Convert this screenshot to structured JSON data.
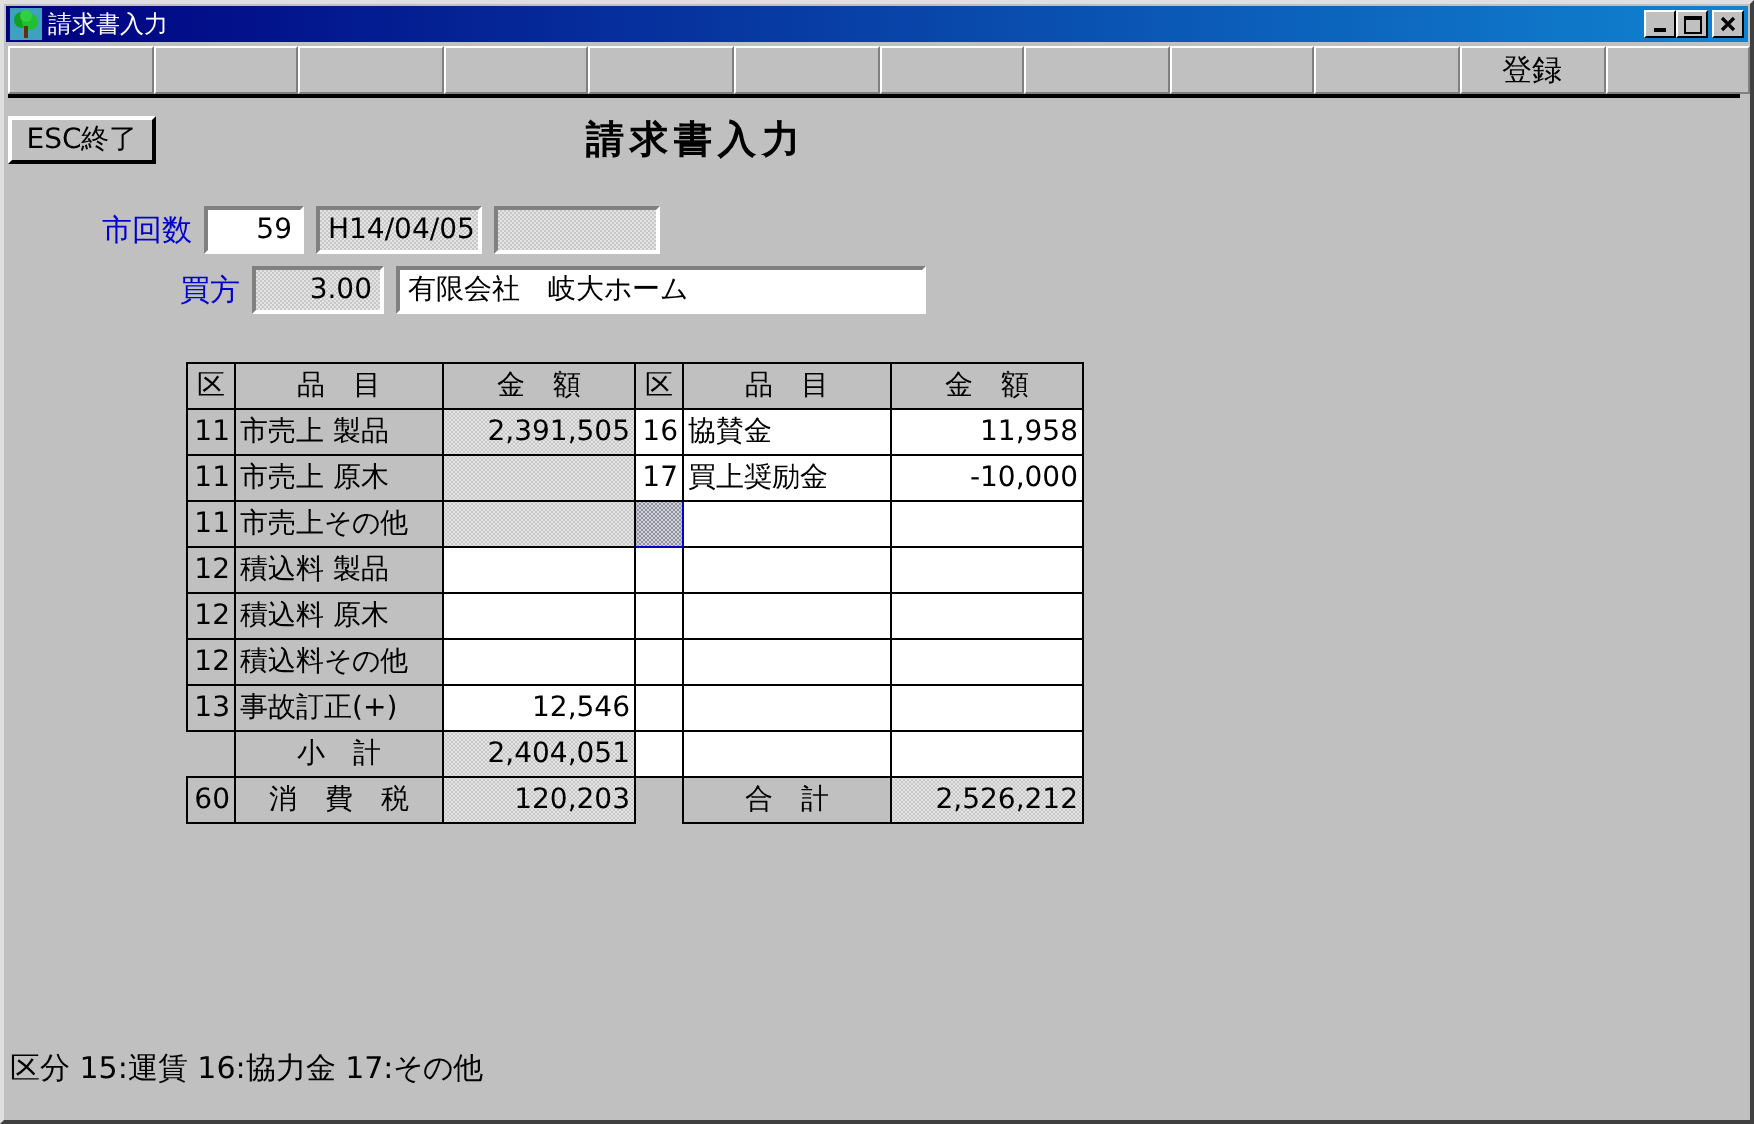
{
  "window": {
    "title": "請求書入力"
  },
  "toolbar": [
    {
      "kind": "blank"
    },
    {
      "kind": "blank"
    },
    {
      "kind": "blank"
    },
    {
      "kind": "blank"
    },
    {
      "kind": "blank"
    },
    {
      "kind": "blank"
    },
    {
      "kind": "blank"
    },
    {
      "kind": "blank"
    },
    {
      "kind": "blank"
    },
    {
      "kind": "blank"
    },
    {
      "kind": "labeled",
      "label": "登録"
    },
    {
      "kind": "blank"
    }
  ],
  "esc_button": "ESC終了",
  "heading": "請求書入力",
  "form_rows": [
    {
      "label": "市回数",
      "fields": [
        {
          "value": "59",
          "readonly": false
        },
        {
          "value": "H14/04/05",
          "readonly": true
        },
        {
          "readonly": true
        }
      ]
    },
    {
      "label": "買方",
      "fields": [
        {
          "value": "3.00",
          "readonly": true
        },
        {
          "value": "有限会社　岐大ホーム",
          "readonly": false
        }
      ]
    }
  ],
  "left_table": {
    "columns": [
      "区",
      "品　目",
      "金　額"
    ],
    "rows": [
      {
        "kind": "item",
        "code": "11",
        "item": "市売上 製品",
        "amount": "2,391,505",
        "readonly": true
      },
      {
        "kind": "item",
        "code": "11",
        "item": "市売上 原木",
        "readonly": true
      },
      {
        "kind": "item",
        "code": "11",
        "item": "市売上その他",
        "readonly": true
      },
      {
        "kind": "item",
        "code": "12",
        "item": "積込料 製品",
        "readonly": false
      },
      {
        "kind": "item",
        "code": "12",
        "item": "積込料 原木",
        "readonly": false
      },
      {
        "kind": "item",
        "code": "12",
        "item": "積込料その他",
        "readonly": false
      },
      {
        "kind": "item",
        "code": "13",
        "item": "事故訂正(+)",
        "amount": "12,546",
        "readonly": false
      },
      {
        "kind": "summary",
        "item": "小　計",
        "amount": "2,404,051",
        "readonly": true
      },
      {
        "kind": "summary_coded",
        "code": "60",
        "item": "消　費　税",
        "amount": "120,203",
        "readonly": true
      }
    ]
  },
  "right_table": {
    "columns": [
      "区",
      "品　目",
      "金　額"
    ],
    "rows": [
      {
        "kind": "item",
        "code": "16",
        "item": "協賛金",
        "amount": "11,958",
        "readonly": false,
        "focused": false
      },
      {
        "kind": "item",
        "code": "17",
        "item": "買上奨励金",
        "amount": "-10,000",
        "readonly": false,
        "focused": false
      },
      {
        "kind": "item",
        "readonly": false,
        "focused": true
      },
      {
        "kind": "item",
        "readonly": false,
        "focused": false
      },
      {
        "kind": "item",
        "readonly": false,
        "focused": false
      },
      {
        "kind": "item",
        "readonly": false,
        "focused": false
      },
      {
        "kind": "item",
        "readonly": false,
        "focused": false
      },
      {
        "kind": "item",
        "readonly": false,
        "focused": false
      },
      {
        "kind": "summary",
        "item": "合　計",
        "amount": "2,526,212",
        "readonly": true,
        "focused": false
      }
    ]
  },
  "status_text": "区分 15:運賃 16:協力金 17:その他"
}
